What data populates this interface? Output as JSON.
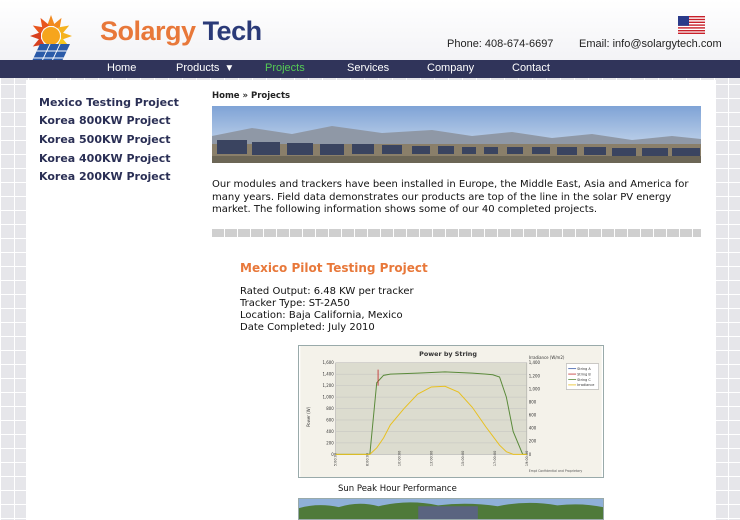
{
  "brand": {
    "name_part1": "Solargy",
    "name_part2": "Tech"
  },
  "header": {
    "phone": "Phone: 408-674-6697",
    "email": "Email: info@solargytech.com",
    "language_flag": "us-flag-icon"
  },
  "nav": {
    "items": [
      {
        "label": "Home",
        "active": false
      },
      {
        "label": "Products",
        "active": false,
        "has_dropdown": true
      },
      {
        "label": "Projects",
        "active": true
      },
      {
        "label": "Services",
        "active": false
      },
      {
        "label": "Company",
        "active": false
      },
      {
        "label": "Contact",
        "active": false
      }
    ],
    "dropdown_caret": "▼"
  },
  "sidebar": {
    "links": [
      "Mexico Testing Project",
      "Korea 800KW Project",
      "Korea 500KW Project",
      "Korea 400KW Project",
      "Korea 200KW Project"
    ]
  },
  "breadcrumb": "Home » Projects",
  "intro": "Our modules and trackers have been installed in Europe, the Middle East, Asia and America for many years. Field data demonstrates our products are top of the line in the solar PV energy market. The following information shows some of our 40 completed projects.",
  "project": {
    "title": "Mexico Pilot Testing Project",
    "details": [
      "Rated Output: 6.48 KW per tracker",
      "Tracker Type: ST-2A50",
      "Location: Baja California, Mexico",
      "Date Completed: July 2010"
    ]
  },
  "chart_data": {
    "type": "line",
    "title": "Power by String",
    "ylabel": "Power (W)",
    "y2label": "Irradiance (W/m2)",
    "ylim": [
      0,
      1600
    ],
    "y2lim": [
      0,
      1400
    ],
    "yticks": [
      "0",
      "200",
      "400",
      "600",
      "800",
      "1,000",
      "1,200",
      "1,400",
      "1,600"
    ],
    "y2ticks": [
      "0",
      "200",
      "400",
      "600",
      "800",
      "1,000",
      "1,200",
      "1,400"
    ],
    "xticks": [
      "5:00:00",
      "8:00:00",
      "10:00:00",
      "13:00:00",
      "15:00:00",
      "17:00:00",
      "19:00:00"
    ],
    "legend_entries": [
      "String A",
      "String B",
      "String C",
      "Irradiance"
    ],
    "legend_position": "top-right",
    "footnote": "Empt Confidential and Proprietary",
    "x": [
      0,
      1.5,
      2.5,
      3,
      3.5,
      4,
      5,
      6,
      7,
      8,
      9,
      10,
      11,
      11.5,
      12,
      12.5,
      13,
      13.7,
      14
    ],
    "series": [
      {
        "name": "String A",
        "color": "#5a8a3a",
        "values": [
          0,
          0,
          0,
          1250,
          1380,
          1400,
          1410,
          1420,
          1430,
          1440,
          1430,
          1420,
          1400,
          1390,
          1350,
          1000,
          400,
          0,
          0
        ]
      },
      {
        "name": "Irradiance",
        "color": "#e8c020",
        "axis": "y2",
        "values": [
          0,
          0,
          0,
          100,
          250,
          450,
          700,
          920,
          1030,
          1040,
          950,
          720,
          420,
          280,
          140,
          40,
          0,
          0,
          0
        ]
      }
    ],
    "grid": true
  },
  "caption": "Sun Peak Hour Performance"
}
